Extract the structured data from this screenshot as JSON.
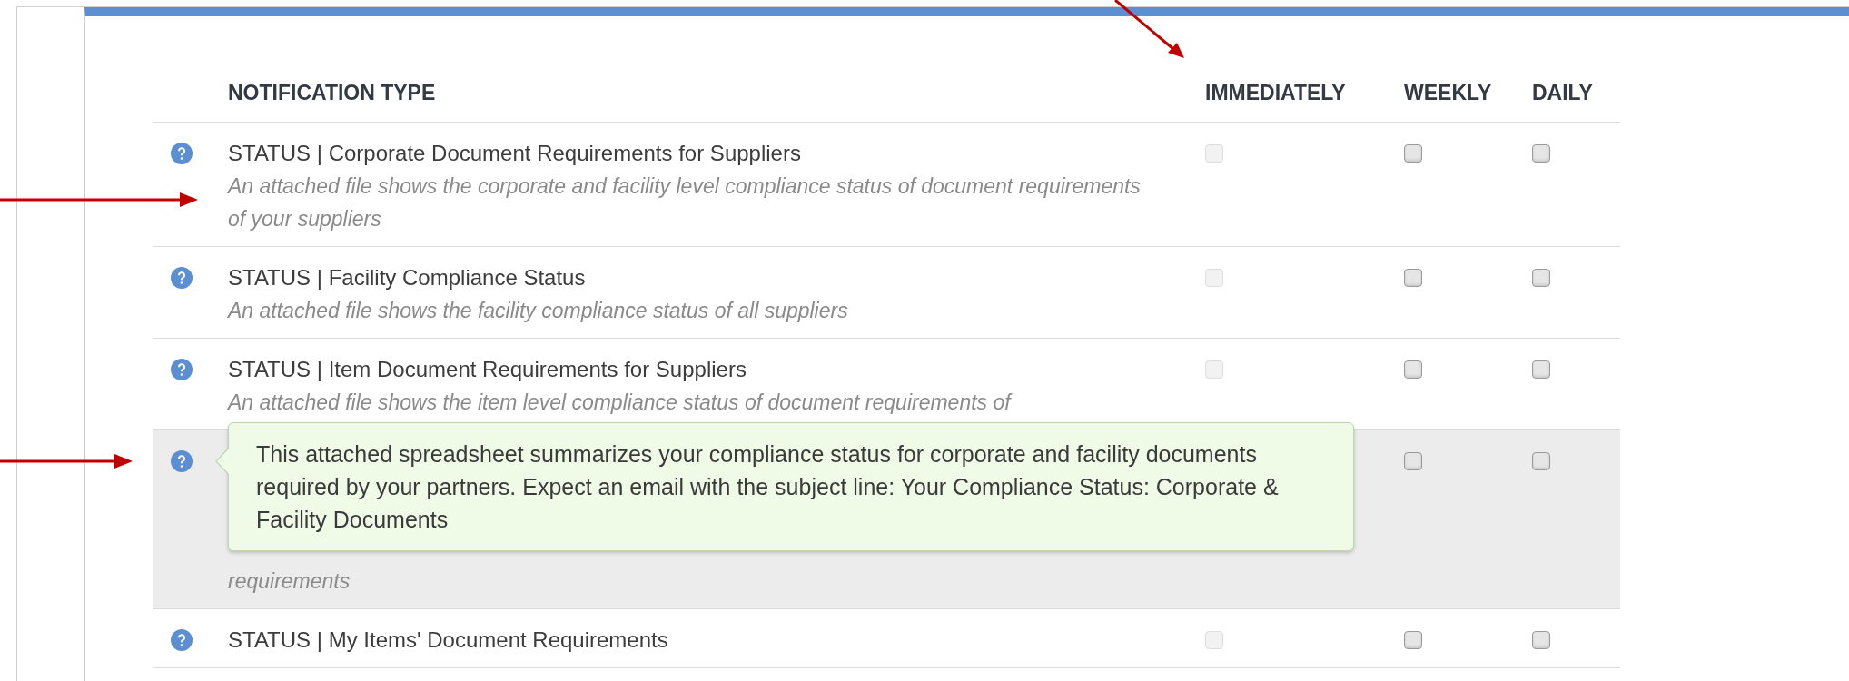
{
  "columns": [
    "NOTIFICATION TYPE",
    "IMMEDIATELY",
    "WEEKLY",
    "DAILY"
  ],
  "rows": [
    {
      "title": "STATUS | Corporate Document Requirements for Suppliers",
      "description": "An attached file shows the corporate and facility level compliance status of document requirements of your suppliers",
      "hovered": false,
      "options": {
        "immediately": {
          "disabled": true,
          "checked": false
        },
        "weekly": {
          "disabled": false,
          "checked": false
        },
        "daily": {
          "disabled": false,
          "checked": false
        }
      }
    },
    {
      "title": "STATUS | Facility Compliance Status",
      "description": "An attached file shows the facility compliance status of all suppliers",
      "hovered": false,
      "options": {
        "immediately": {
          "disabled": true,
          "checked": false
        },
        "weekly": {
          "disabled": false,
          "checked": false
        },
        "daily": {
          "disabled": false,
          "checked": false
        }
      }
    },
    {
      "title": "STATUS | Item Document Requirements for Suppliers",
      "description": "An attached file shows the item level compliance status of document requirements of",
      "hovered": false,
      "options": {
        "immediately": {
          "disabled": true,
          "checked": false
        },
        "weekly": {
          "disabled": false,
          "checked": false
        },
        "daily": {
          "disabled": false,
          "checked": false
        }
      }
    },
    {
      "description": "requirements",
      "hovered": true,
      "tooltip": "This attached spreadsheet summarizes your compliance status for corporate and facility documents required by your partners. Expect an email with the subject line: Your Compliance Status: Corporate & Facility Documents",
      "options": {
        "weekly": {
          "disabled": false,
          "checked": false
        },
        "daily": {
          "disabled": false,
          "checked": false
        }
      }
    },
    {
      "title": "STATUS | My Items' Document Requirements",
      "hovered": false,
      "options": {
        "immediately": {
          "disabled": true,
          "checked": false
        },
        "weekly": {
          "disabled": false,
          "checked": false
        },
        "daily": {
          "disabled": false,
          "checked": false
        }
      }
    }
  ]
}
